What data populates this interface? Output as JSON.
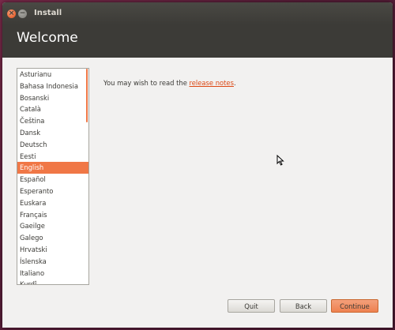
{
  "window": {
    "title": "Install",
    "close_glyph": "×",
    "minimize_glyph": "−"
  },
  "header": {
    "title": "Welcome"
  },
  "languages": {
    "items": [
      "Asturianu",
      "Bahasa Indonesia",
      "Bosanski",
      "Català",
      "Čeština",
      "Dansk",
      "Deutsch",
      "Eesti",
      "English",
      "Español",
      "Esperanto",
      "Euskara",
      "Français",
      "Gaeilge",
      "Galego",
      "Hrvatski",
      "Íslenska",
      "Italiano",
      "Kurdî"
    ],
    "selected": "English"
  },
  "content": {
    "notes_prefix": "You may wish to read the ",
    "notes_link": "release notes",
    "notes_suffix": "."
  },
  "buttons": {
    "quit": "Quit",
    "back": "Back",
    "continue": "Continue"
  },
  "colors": {
    "accent": "#f07746",
    "header_bg": "#3c3b37",
    "link": "#dd4814"
  },
  "icons": {
    "close": "close-icon",
    "minimize": "minimize-icon",
    "cursor": "mouse-pointer-icon"
  }
}
